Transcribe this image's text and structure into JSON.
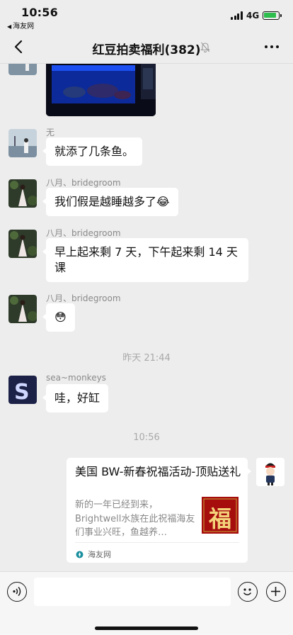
{
  "status_bar": {
    "time": "10:56",
    "back_app": "海友网",
    "network": "4G"
  },
  "nav": {
    "title": "红豆拍卖福利(382)"
  },
  "messages": [
    {
      "sender": "无",
      "text": "就添了几条鱼。"
    },
    {
      "sender": "八月、bridegroom",
      "text": "我们假是越睡越多了😂"
    },
    {
      "sender": "八月、bridegroom",
      "text": "早上起来剩 7 天，下午起来剩 14 天课"
    },
    {
      "sender": "八月、bridegroom",
      "text": "😳"
    },
    {
      "sender": "sea~monkeys",
      "text": "哇，好缸"
    }
  ],
  "timestamps": [
    "昨天 21:44",
    "10:56"
  ],
  "card": {
    "title": "美国 BW-新春祝福活动-顶贴送礼",
    "description": "新的一年已经到来，Brightwell水族在此祝福海友们事业兴旺，鱼越养…",
    "thumb_text": "福",
    "source": "海友网"
  },
  "icons": {
    "back": "chevron-left-icon",
    "mute": "bell-off-icon",
    "more": "more-dots-icon",
    "voice": "voice-icon",
    "emoji": "emoji-icon",
    "plus": "plus-icon"
  },
  "colors": {
    "background": "#ededed",
    "bubble": "#ffffff",
    "battery": "#2dbe4e",
    "card_thumb": "#a60d0d"
  }
}
